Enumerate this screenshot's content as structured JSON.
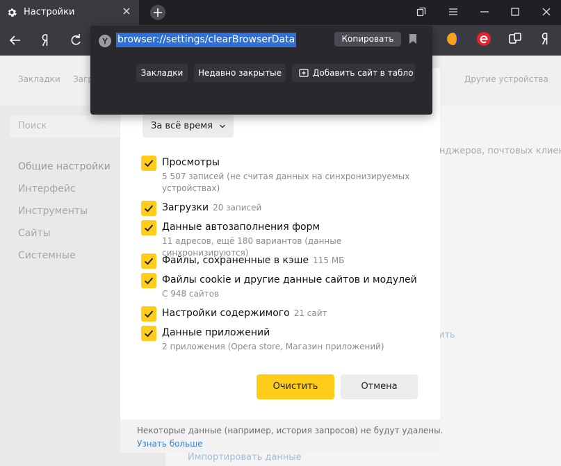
{
  "tab": {
    "title": "Настройки"
  },
  "popup": {
    "url": "browser://settings/clearBrowserData",
    "copy_label": "Копировать",
    "chips": [
      "Закладки",
      "Недавно закрытые",
      "Добавить сайт в табло"
    ]
  },
  "background": {
    "top_nav": [
      "Закладки",
      "Загр",
      "Другие устройства"
    ],
    "search_placeholder": "Поиск",
    "left_nav": [
      "Общие настройки",
      "Интерфейс",
      "Инструменты",
      "Сайты",
      "Системные"
    ],
    "right_snippet": "нджеров, почтовых клиен",
    "right_link_fragment": "ить",
    "bottom_link": "Импортировать данные"
  },
  "dialog": {
    "time_range": "За всё время",
    "items": [
      {
        "label": "Просмотры",
        "count": "",
        "sub": "5 507 записей (не считая данных на синхронизируемых устройствах)"
      },
      {
        "label": "Загрузки",
        "count": "20 записей",
        "sub": ""
      },
      {
        "label": "Данные автозаполнения форм",
        "count": "",
        "sub": "11 адресов, ещё 180 вариантов (данные синхронизируются)"
      },
      {
        "label": "Файлы, сохраненные в кэше",
        "count": "115 МБ",
        "sub": ""
      },
      {
        "label": "Файлы cookie и другие данные сайтов и модулей",
        "count": "",
        "sub": "С 948 сайтов"
      },
      {
        "label": "Настройки содержимого",
        "count": "21 сайт",
        "sub": ""
      },
      {
        "label": "Данные приложений",
        "count": "",
        "sub": "2 приложения (Opera store, Магазин приложений)"
      }
    ],
    "clear_label": "Очистить",
    "cancel_label": "Отмена",
    "footer_note": "Некоторые данные (например, история запросов) не будут удалены.",
    "footer_link": "Узнать больше"
  },
  "colors": {
    "accent": "#ffcc1a",
    "link": "#3a7fcf",
    "selection": "#2f6fd8",
    "chrome": "#3a3a41"
  },
  "icons": [
    "gear-icon",
    "close-icon",
    "plus-icon",
    "pages-icon",
    "menu-icon",
    "minimize-icon",
    "maximize-icon",
    "back-arrow-icon",
    "yandex-logo-icon",
    "reload-icon",
    "bookmark-icon",
    "chevron-down-icon",
    "checkmark-icon"
  ]
}
